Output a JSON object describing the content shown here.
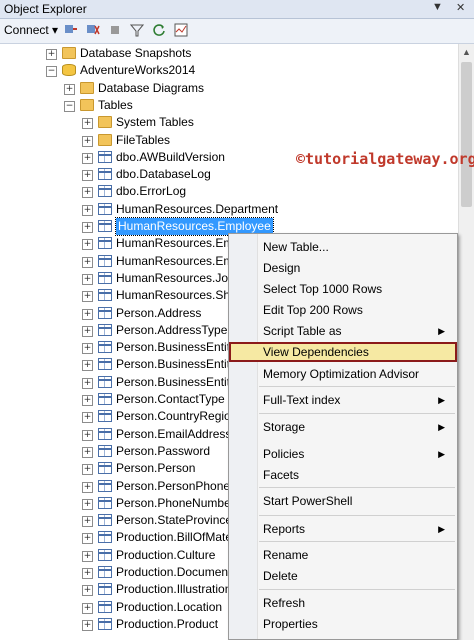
{
  "window": {
    "title": "Object Explorer",
    "pin": "▼",
    "close": "✕"
  },
  "toolbar": {
    "connect_label": "Connect",
    "connect_arrow": "▾"
  },
  "watermark": "©tutorialgateway.org",
  "tree": [
    {
      "label": "Database Snapshots",
      "icon": "folder-icon",
      "expander": "+",
      "indent": 0
    },
    {
      "label": "AdventureWorks2014",
      "icon": "database-icon",
      "expander": "−",
      "indent": 0
    },
    {
      "label": "Database Diagrams",
      "icon": "folder-icon",
      "expander": "+",
      "indent": 1
    },
    {
      "label": "Tables",
      "icon": "folder-icon",
      "expander": "−",
      "indent": 1
    },
    {
      "label": "System Tables",
      "icon": "folder-icon",
      "expander": "+",
      "indent": 2
    },
    {
      "label": "FileTables",
      "icon": "folder-icon",
      "expander": "+",
      "indent": 2
    },
    {
      "label": "dbo.AWBuildVersion",
      "icon": "table-icon",
      "expander": "+",
      "indent": 2
    },
    {
      "label": "dbo.DatabaseLog",
      "icon": "table-icon",
      "expander": "+",
      "indent": 2
    },
    {
      "label": "dbo.ErrorLog",
      "icon": "table-icon",
      "expander": "+",
      "indent": 2
    },
    {
      "label": "HumanResources.Department",
      "icon": "table-icon",
      "expander": "+",
      "indent": 2
    },
    {
      "label": "HumanResources.Employee",
      "icon": "table-icon",
      "expander": "+",
      "indent": 2,
      "selected": true
    },
    {
      "label": "HumanResources.Emp",
      "icon": "table-icon",
      "expander": "+",
      "indent": 2
    },
    {
      "label": "HumanResources.Emp",
      "icon": "table-icon",
      "expander": "+",
      "indent": 2
    },
    {
      "label": "HumanResources.JobC",
      "icon": "table-icon",
      "expander": "+",
      "indent": 2
    },
    {
      "label": "HumanResources.Shift",
      "icon": "table-icon",
      "expander": "+",
      "indent": 2
    },
    {
      "label": "Person.Address",
      "icon": "table-icon",
      "expander": "+",
      "indent": 2
    },
    {
      "label": "Person.AddressType",
      "icon": "table-icon",
      "expander": "+",
      "indent": 2
    },
    {
      "label": "Person.BusinessEntity",
      "icon": "table-icon",
      "expander": "+",
      "indent": 2
    },
    {
      "label": "Person.BusinessEntityA",
      "icon": "table-icon",
      "expander": "+",
      "indent": 2
    },
    {
      "label": "Person.BusinessEntityC",
      "icon": "table-icon",
      "expander": "+",
      "indent": 2
    },
    {
      "label": "Person.ContactType",
      "icon": "table-icon",
      "expander": "+",
      "indent": 2
    },
    {
      "label": "Person.CountryRegion",
      "icon": "table-icon",
      "expander": "+",
      "indent": 2
    },
    {
      "label": "Person.EmailAddress",
      "icon": "table-icon",
      "expander": "+",
      "indent": 2
    },
    {
      "label": "Person.Password",
      "icon": "table-icon",
      "expander": "+",
      "indent": 2
    },
    {
      "label": "Person.Person",
      "icon": "table-icon",
      "expander": "+",
      "indent": 2
    },
    {
      "label": "Person.PersonPhone",
      "icon": "table-icon",
      "expander": "+",
      "indent": 2
    },
    {
      "label": "Person.PhoneNumber",
      "icon": "table-icon",
      "expander": "+",
      "indent": 2
    },
    {
      "label": "Person.StateProvince",
      "icon": "table-icon",
      "expander": "+",
      "indent": 2
    },
    {
      "label": "Production.BillOfMate",
      "icon": "table-icon",
      "expander": "+",
      "indent": 2
    },
    {
      "label": "Production.Culture",
      "icon": "table-icon",
      "expander": "+",
      "indent": 2
    },
    {
      "label": "Production.Document",
      "icon": "table-icon",
      "expander": "+",
      "indent": 2
    },
    {
      "label": "Production.Illustration",
      "icon": "table-icon",
      "expander": "+",
      "indent": 2
    },
    {
      "label": "Production.Location",
      "icon": "table-icon",
      "expander": "+",
      "indent": 2
    },
    {
      "label": "Production.Product",
      "icon": "table-icon",
      "expander": "+",
      "indent": 2
    }
  ],
  "context_menu": [
    {
      "label": "New Table...",
      "submenu": false
    },
    {
      "label": "Design",
      "submenu": false
    },
    {
      "label": "Select Top 1000 Rows",
      "submenu": false
    },
    {
      "label": "Edit Top 200 Rows",
      "submenu": false
    },
    {
      "label": "Script Table as",
      "submenu": true
    },
    {
      "label": "View Dependencies",
      "submenu": false,
      "highlighted": true
    },
    {
      "label": "Memory Optimization Advisor",
      "submenu": false
    },
    {
      "label": "Full-Text index",
      "submenu": true
    },
    {
      "label": "Storage",
      "submenu": true
    },
    {
      "label": "Policies",
      "submenu": true
    },
    {
      "label": "Facets",
      "submenu": false
    },
    {
      "label": "Start PowerShell",
      "submenu": false
    },
    {
      "label": "Reports",
      "submenu": true
    },
    {
      "label": "Rename",
      "submenu": false
    },
    {
      "label": "Delete",
      "submenu": false
    },
    {
      "label": "Refresh",
      "submenu": false
    },
    {
      "label": "Properties",
      "submenu": false
    }
  ],
  "submenu_arrow": "▶",
  "colors": {
    "selection": "#3399ff",
    "highlight_border": "#8b1a1a",
    "watermark": "#c0392b"
  }
}
